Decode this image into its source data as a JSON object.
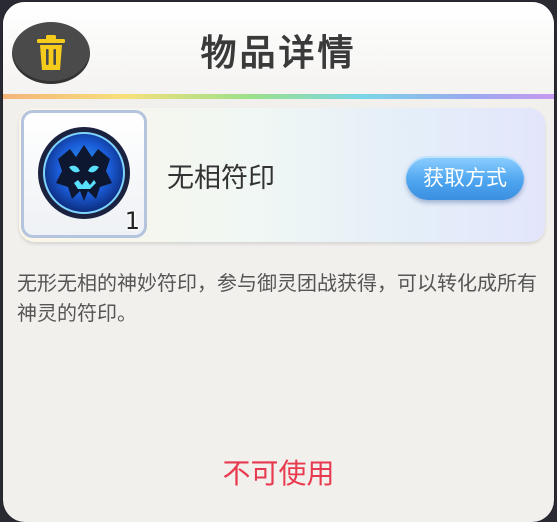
{
  "header": {
    "title": "物品详情",
    "delete_icon": "trash-icon"
  },
  "item": {
    "name": "无相符印",
    "count": "1",
    "icon": "blue-ghost-seal-icon",
    "obtain_button_label": "获取方式"
  },
  "description": "无形无相的神妙符印，参与御灵团战获得，可以转化成所有神灵的符印。",
  "status": "不可使用",
  "colors": {
    "status_red": "#e83a4e",
    "button_blue": "#4fa6f0",
    "delete_button_bg": "#4a4a4a",
    "delete_icon_yellow": "#f5cc1c"
  }
}
